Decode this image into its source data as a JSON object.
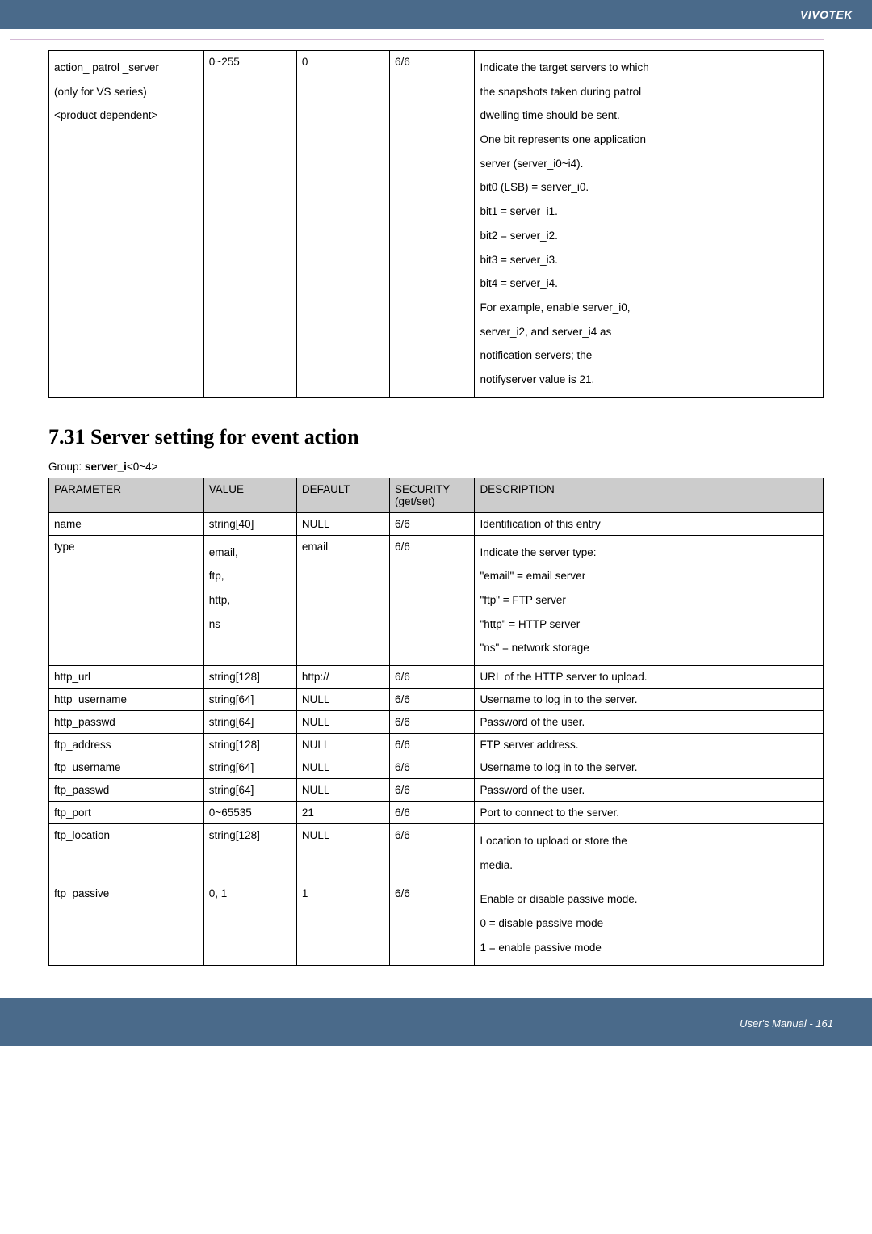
{
  "header": {
    "brand": "VIVOTEK"
  },
  "table1": {
    "row": {
      "param_line1": "action_ patrol _server",
      "param_line2": "(only for VS series)",
      "param_line3": "<product dependent>",
      "value": "0~255",
      "default": "0",
      "security": "6/6",
      "desc_lines": [
        "Indicate the target servers to which",
        "the snapshots taken during patrol",
        "dwelling time should be sent.",
        "One bit represents one application",
        "server (server_i0~i4).",
        "bit0 (LSB) = server_i0.",
        "bit1 = server_i1.",
        "bit2 = server_i2.",
        "bit3 = server_i3.",
        "bit4 = server_i4.",
        "For example, enable server_i0,",
        "server_i2, and server_i4 as",
        "notification servers; the",
        "notifyserver value is 21."
      ]
    }
  },
  "section": {
    "title": "7.31 Server setting for event action",
    "group_prefix": "Group: ",
    "group_bold": "server_i",
    "group_suffix": "<0~4>"
  },
  "table2": {
    "headers": {
      "parameter": "PARAMETER",
      "value": "VALUE",
      "default": "DEFAULT",
      "security": "SECURITY",
      "security_sub": "(get/set)",
      "description": "DESCRIPTION"
    },
    "rows": [
      {
        "param": "name",
        "value": "string[40]",
        "default": "NULL",
        "security": "6/6",
        "desc": "Identification of this entry"
      },
      {
        "param": "type",
        "value_lines": [
          "email,",
          "ftp,",
          "http,",
          "ns"
        ],
        "default": "email",
        "security": "6/6",
        "desc_lines": [
          "Indicate the server type:",
          "\"email\" = email server",
          "\"ftp\" = FTP server",
          "\"http\" = HTTP server",
          "\"ns\" = network storage"
        ]
      },
      {
        "param": "http_url",
        "value": "string[128]",
        "default": "http://",
        "security": "6/6",
        "desc": "URL of the HTTP server to upload."
      },
      {
        "param": "http_username",
        "value": "string[64]",
        "default": "NULL",
        "security": "6/6",
        "desc": "Username to log in to the server."
      },
      {
        "param": "http_passwd",
        "value": "string[64]",
        "default": "NULL",
        "security": "6/6",
        "desc": "Password of the user."
      },
      {
        "param": "ftp_address",
        "value": "string[128]",
        "default": "NULL",
        "security": "6/6",
        "desc": "FTP server address."
      },
      {
        "param": "ftp_username",
        "value": "string[64]",
        "default": "NULL",
        "security": "6/6",
        "desc": "Username to log in to the server."
      },
      {
        "param": "ftp_passwd",
        "value": "string[64]",
        "default": "NULL",
        "security": "6/6",
        "desc": "Password of the user."
      },
      {
        "param": "ftp_port",
        "value": "0~65535",
        "default": "21",
        "security": "6/6",
        "desc": "Port to connect to the server."
      },
      {
        "param": "ftp_location",
        "value": "string[128]",
        "default": "NULL",
        "security": "6/6",
        "desc_lines": [
          "Location to upload or store the",
          "media."
        ]
      },
      {
        "param": "ftp_passive",
        "value": "0, 1",
        "default": "1",
        "security": "6/6",
        "desc_lines": [
          "Enable or disable passive mode.",
          "0 = disable passive mode",
          "1 = enable passive mode"
        ]
      }
    ]
  },
  "footer": {
    "text": "User's Manual - 161"
  }
}
